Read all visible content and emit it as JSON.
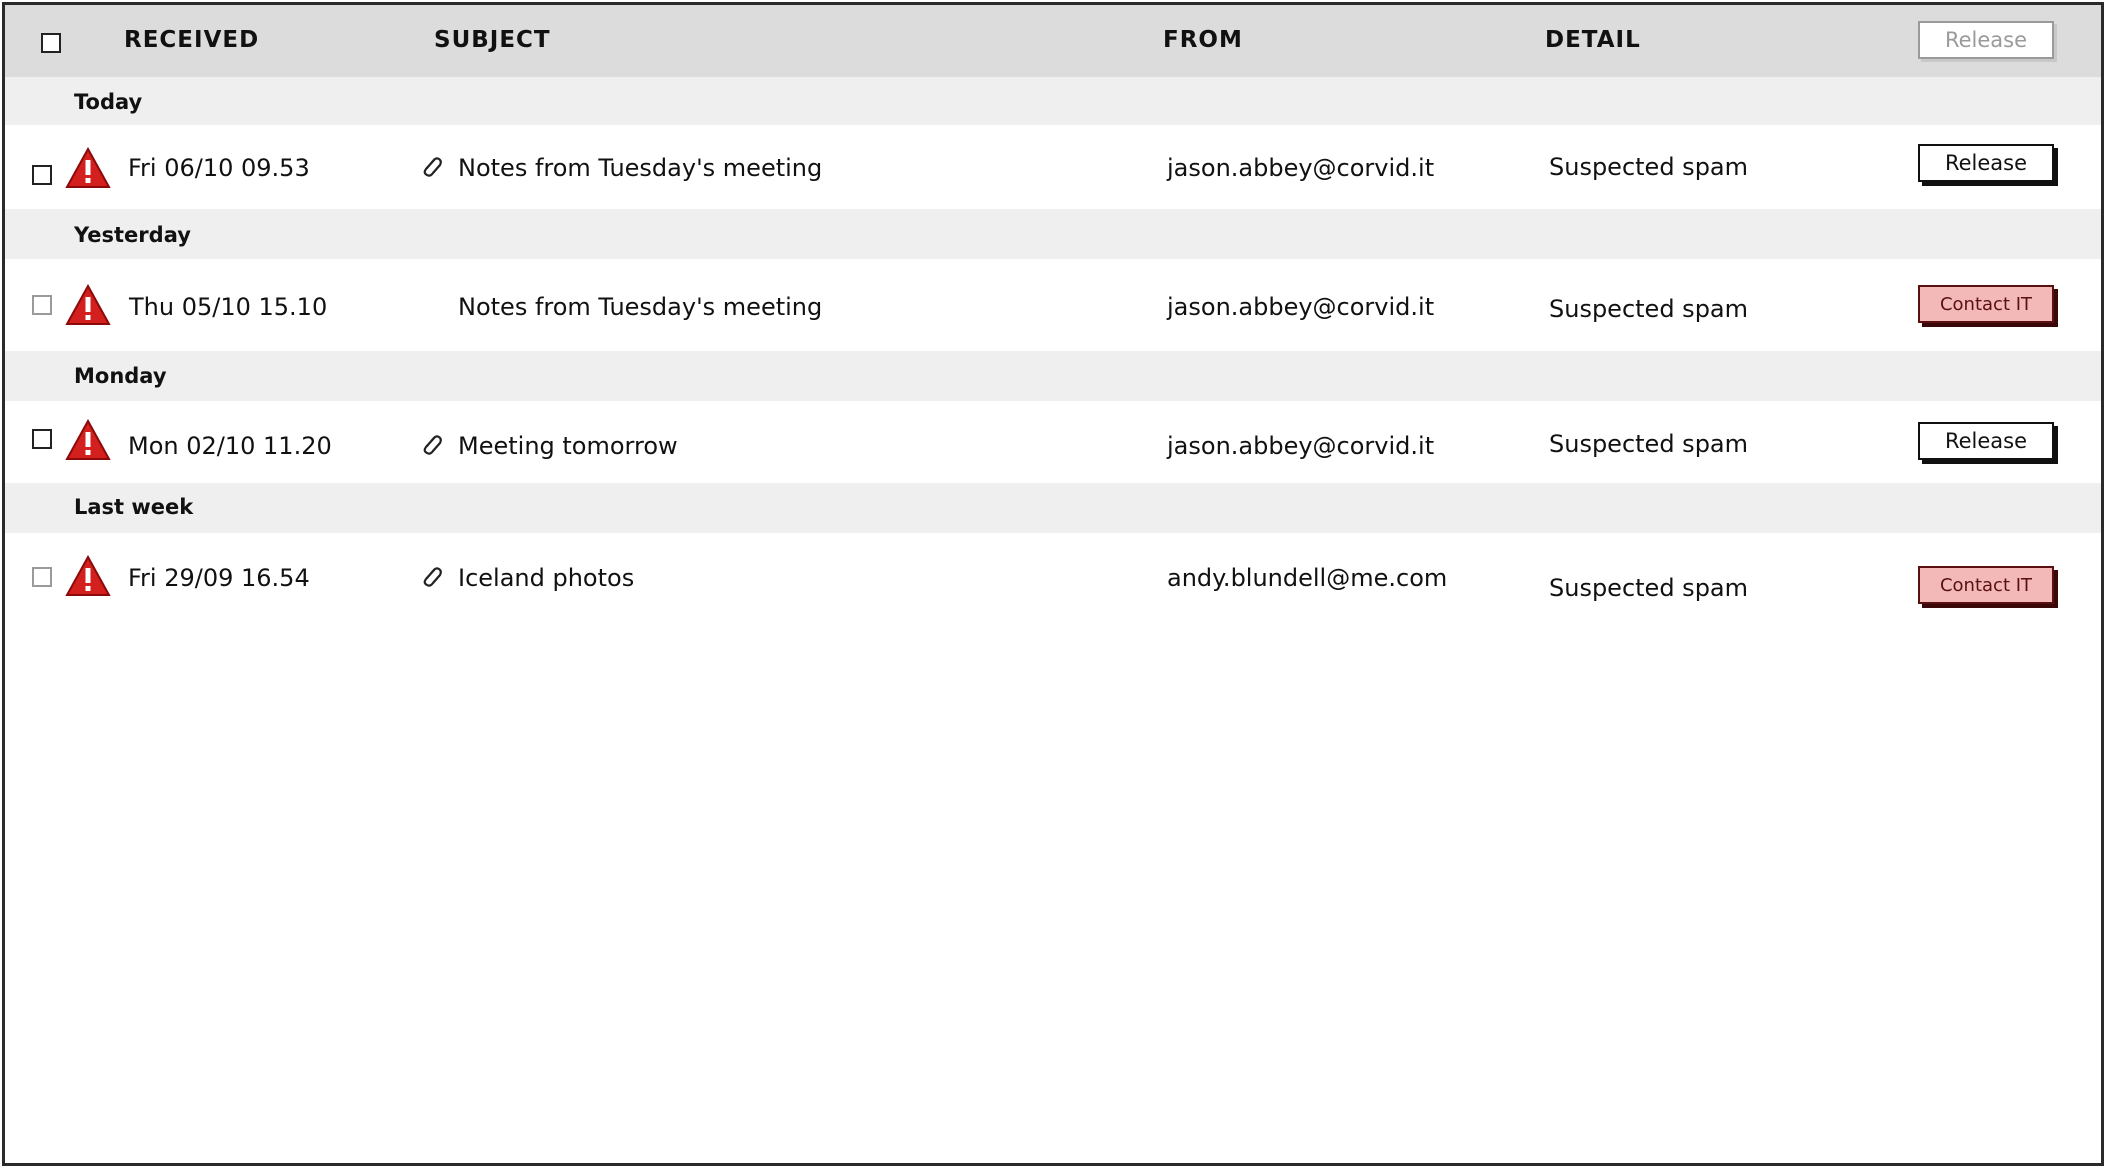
{
  "header": {
    "received": "RECEIVED",
    "subject": "SUBJECT",
    "from": "FROM",
    "detail": "DETAIL",
    "release_label": "Release"
  },
  "groups": [
    {
      "label": "Today",
      "rows": [
        {
          "received": "Fri 06/10 09.53",
          "attachment": true,
          "subject": "Notes from Tuesday's meeting",
          "from": "jason.abbey@corvid.it",
          "detail": "Suspected spam",
          "action": "Release"
        }
      ]
    },
    {
      "label": "Yesterday",
      "rows": [
        {
          "received": "Thu 05/10 15.10",
          "attachment": false,
          "subject": "Notes from Tuesday's meeting",
          "from": "jason.abbey@corvid.it",
          "detail": "Suspected spam",
          "action": "Contact IT"
        }
      ]
    },
    {
      "label": "Monday",
      "rows": [
        {
          "received": "Mon 02/10 11.20",
          "attachment": true,
          "subject": "Meeting tomorrow",
          "from": "jason.abbey@corvid.it",
          "detail": "Suspected spam",
          "action": "Release"
        }
      ]
    },
    {
      "label": "Last week",
      "rows": [
        {
          "received": "Fri 29/09 16.54",
          "attachment": true,
          "subject": "Iceland photos",
          "from": "andy.blundell@me.com",
          "detail": "Suspected spam",
          "action": "Contact IT"
        }
      ]
    }
  ],
  "icons": {
    "warning": "warning-triangle-icon",
    "attachment": "paperclip-icon"
  },
  "colors": {
    "warning_red": "#d41f1f",
    "contact_bg": "#f3b8b8",
    "contact_text": "#5a1010",
    "header_bg": "#dcdcdc",
    "group_bg": "#efefef"
  }
}
